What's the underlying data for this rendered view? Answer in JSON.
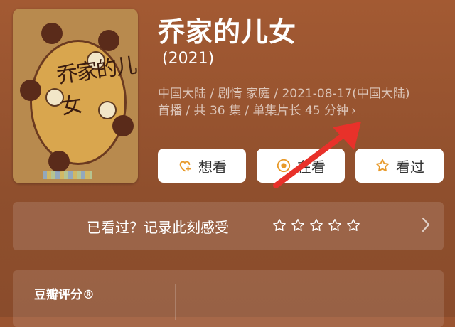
{
  "movie": {
    "title": "乔家的儿女",
    "year": "(2021)",
    "meta_line1": "中国大陆 / 剧情 家庭 / 2021-08-17(中国大陆)",
    "meta_line2": "首播 / 共 36 集 / 单集片长 45 分钟",
    "poster_title_art": "乔家的儿女"
  },
  "actions": {
    "want": "想看",
    "watching": "在看",
    "watched": "看过"
  },
  "record": {
    "prompt": "已看过？记录此刻感受",
    "stars_total": 5
  },
  "rating": {
    "label": "豆瓣评分®"
  },
  "colors": {
    "background": "#9a5430",
    "accent": "#e89a2a",
    "arrow": "#e8312a"
  }
}
